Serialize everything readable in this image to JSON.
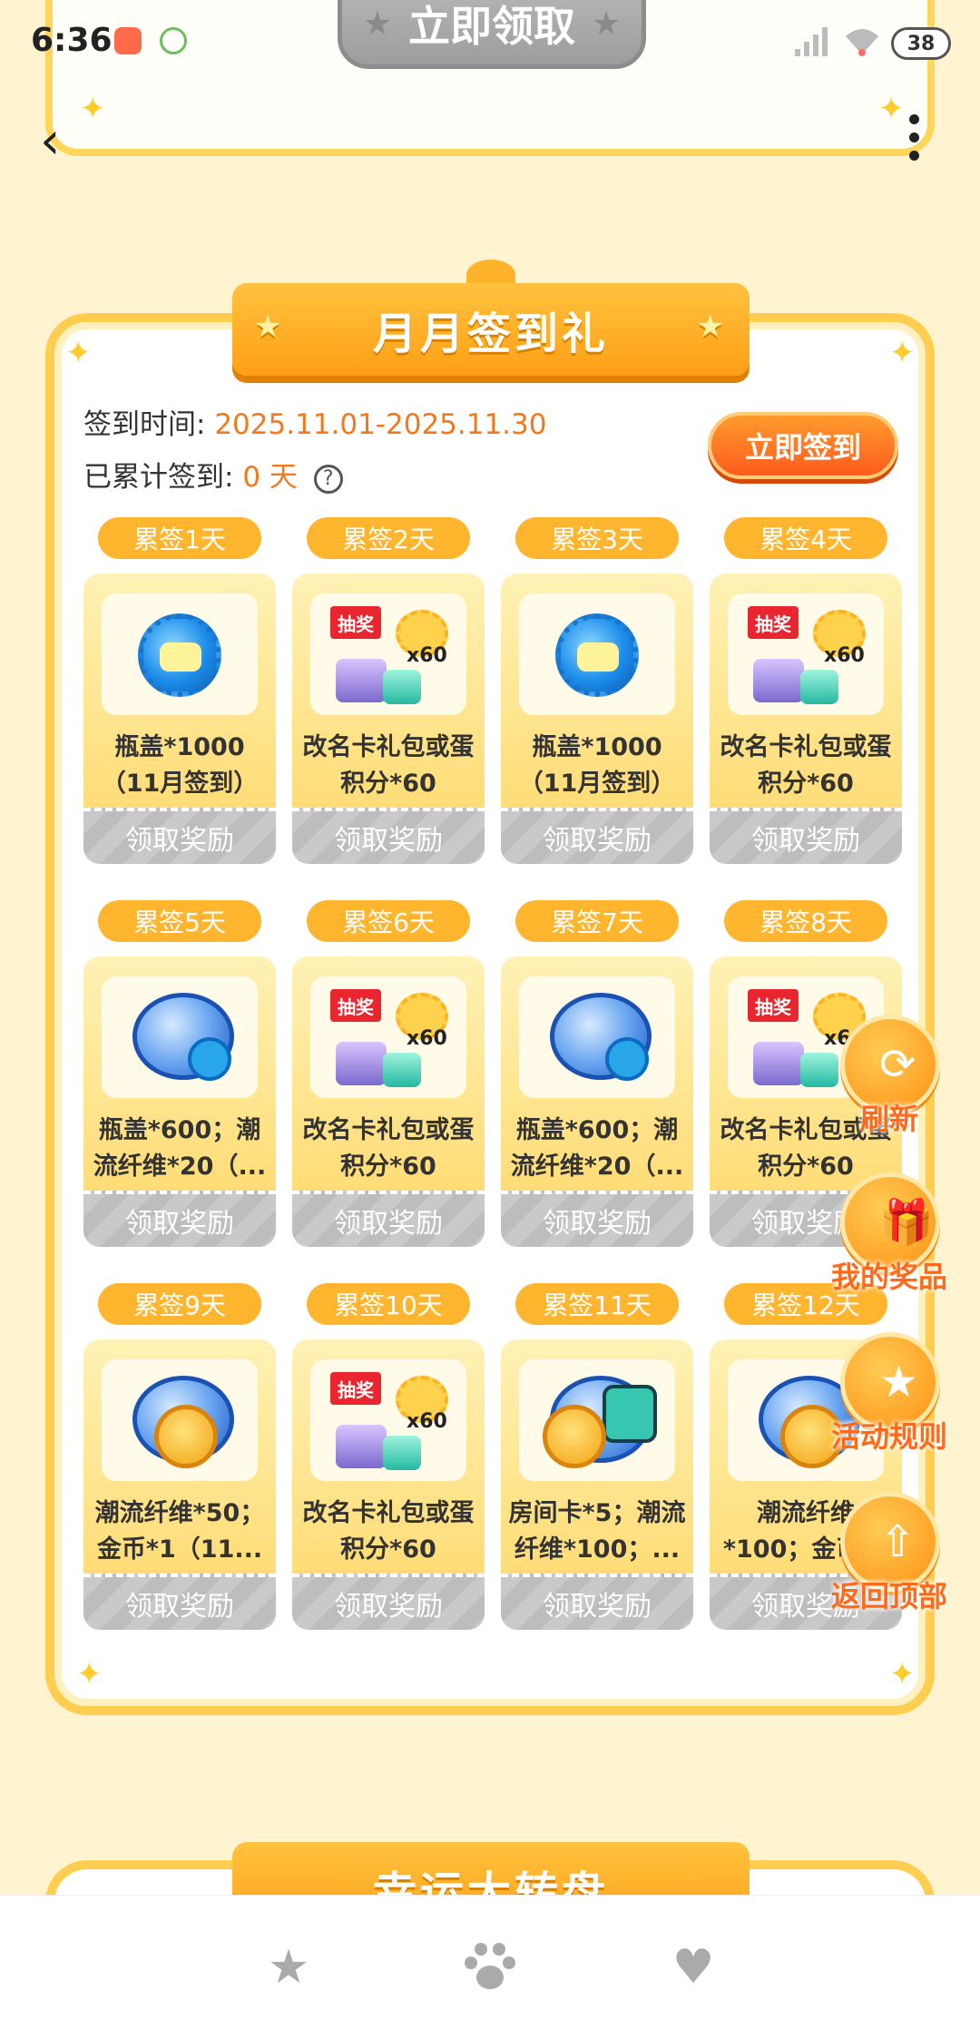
{
  "status_bar": {
    "time": "6:36",
    "battery": "38"
  },
  "top_section": {
    "claim_label": "立即领取"
  },
  "sign_section": {
    "title": "月月签到礼",
    "period_label": "签到时间:",
    "period_value": "2025.11.01-2025.11.30",
    "accum_label": "已累计签到:",
    "accum_value": "0 天",
    "help": "?",
    "sign_button": "立即签到",
    "rewards": [
      {
        "day": "累签1天",
        "text": "瓶盖*1000（11月签到）",
        "icon": "bottle-cap-icon",
        "button": "领取奖励"
      },
      {
        "day": "累签2天",
        "text": "改名卡礼包或蛋积分*60",
        "icon": "lottery-gift-icon",
        "button": "领取奖励"
      },
      {
        "day": "累签3天",
        "text": "瓶盖*1000（11月签到）",
        "icon": "bottle-cap-icon",
        "button": "领取奖励"
      },
      {
        "day": "累签4天",
        "text": "改名卡礼包或蛋积分*60",
        "icon": "lottery-gift-icon",
        "button": "领取奖励"
      },
      {
        "day": "累签5天",
        "text": "瓶盖*600；潮流纤维*20（...",
        "icon": "fiber-cap-icon",
        "button": "领取奖励"
      },
      {
        "day": "累签6天",
        "text": "改名卡礼包或蛋积分*60",
        "icon": "lottery-gift-icon",
        "button": "领取奖励"
      },
      {
        "day": "累签7天",
        "text": "瓶盖*600；潮流纤维*20（...",
        "icon": "fiber-cap-icon",
        "button": "领取奖励"
      },
      {
        "day": "累签8天",
        "text": "改名卡礼包或蛋积分*60",
        "icon": "lottery-gift-icon",
        "button": "领取奖励"
      },
      {
        "day": "累签9天",
        "text": "潮流纤维*50；金币*1（11...",
        "icon": "fiber-coin-icon",
        "button": "领取奖励"
      },
      {
        "day": "累签10天",
        "text": "改名卡礼包或蛋积分*60",
        "icon": "lottery-gift-icon",
        "button": "领取奖励"
      },
      {
        "day": "累签11天",
        "text": "房间卡*5；潮流纤维*100；...",
        "icon": "room-card-icon",
        "button": "领取奖励"
      },
      {
        "day": "累签12天",
        "text": "潮流纤维*100；金币...",
        "icon": "fiber-coin-icon",
        "button": "领取奖励"
      }
    ],
    "gift_tag": "抽奖",
    "gift_count": "x60"
  },
  "floating_buttons": [
    {
      "label": "刷新",
      "icon": "refresh-icon"
    },
    {
      "label": "我的奖品",
      "icon": "gift-box-icon"
    },
    {
      "label": "活动规则",
      "icon": "star-icon"
    },
    {
      "label": "返回顶部",
      "icon": "arrow-up-icon"
    }
  ],
  "next_section": {
    "title": "幸运大转盘"
  },
  "bottom_nav": [
    {
      "icon": "star-icon"
    },
    {
      "icon": "paw-icon"
    },
    {
      "icon": "heart-icon"
    }
  ],
  "colors": {
    "accent": "#ff9f16",
    "date_orange": "#f07a1d",
    "card_border": "#ffcd4f"
  }
}
